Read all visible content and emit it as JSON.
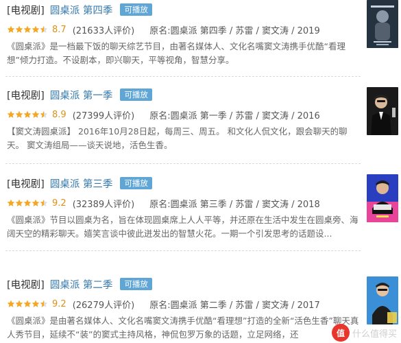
{
  "results": [
    {
      "category": "[电视剧]",
      "title": "圆桌派 第四季",
      "play_label": "可播放",
      "rating": "8.7",
      "stars": 4.5,
      "rating_count": "(21633人评价)",
      "meta": "原名:圆桌派 第四季 / 苏雷 / 窦文涛 / 2019",
      "description": "《圆桌派》是一档最下饭的聊天综艺节目，由著名媒体人、文化名嘴窦文涛携手优酷“看理想”倾力打造。不设剧本，即兴聊天，平等视角，智慧分享。",
      "poster_icon": "poster-roundtable-s4"
    },
    {
      "category": "[电视剧]",
      "title": "圆桌派 第一季",
      "play_label": "可播放",
      "rating": "8.9",
      "stars": 4.5,
      "rating_count": "(27399人评价)",
      "meta": "原名:圆桌派 第一季 / 苏雷 / 窦文涛 / 2016",
      "description": "【窦文涛圆桌派】 2016年10月28日起，每周三、周五。 和文化人侃文化，跟会聊天的聊天。 窦文涛组局——谈天说地，活色生香。",
      "poster_icon": "poster-roundtable-s1"
    },
    {
      "category": "[电视剧]",
      "title": "圆桌派 第三季",
      "play_label": "可播放",
      "rating": "9.2",
      "stars": 4.5,
      "rating_count": "(32389人评价)",
      "meta": "原名:圆桌派 第三季 / 苏雷 / 窦文涛 / 2018",
      "description": "《圆桌派》节目以圆桌为名，旨在体现圆桌席上人人平等，并还原在生活中发生在圆桌旁、海阔天空的精彩聊天。嬉笑言谈中彼此迸发出的智慧火花。一期一个引发思考的话题设...",
      "poster_icon": "poster-roundtable-s3"
    },
    {
      "category": "[电视剧]",
      "title": "圆桌派 第二季",
      "play_label": "可播放",
      "rating": "9.2",
      "stars": 4.5,
      "rating_count": "(26279人评价)",
      "meta": "原名:圆桌派 第二季 / 苏雷 / 窦文涛 / 2017",
      "description": "《圆桌派》是由著名媒体人、文化名嘴窦文涛携手优酷“看理想”打造的全新“活色生香”聊天真人秀节目，延续不“装”的窦式主持风格，神侃包罗万象的话题，立足网络，还",
      "poster_icon": "poster-roundtable-s2"
    }
  ],
  "watermark": {
    "badge": "值",
    "text": "什么值得买"
  },
  "colors": {
    "link": "#3377aa",
    "badge": "#5fa6d6",
    "star": "#f5a623",
    "rating": "#e09015"
  }
}
